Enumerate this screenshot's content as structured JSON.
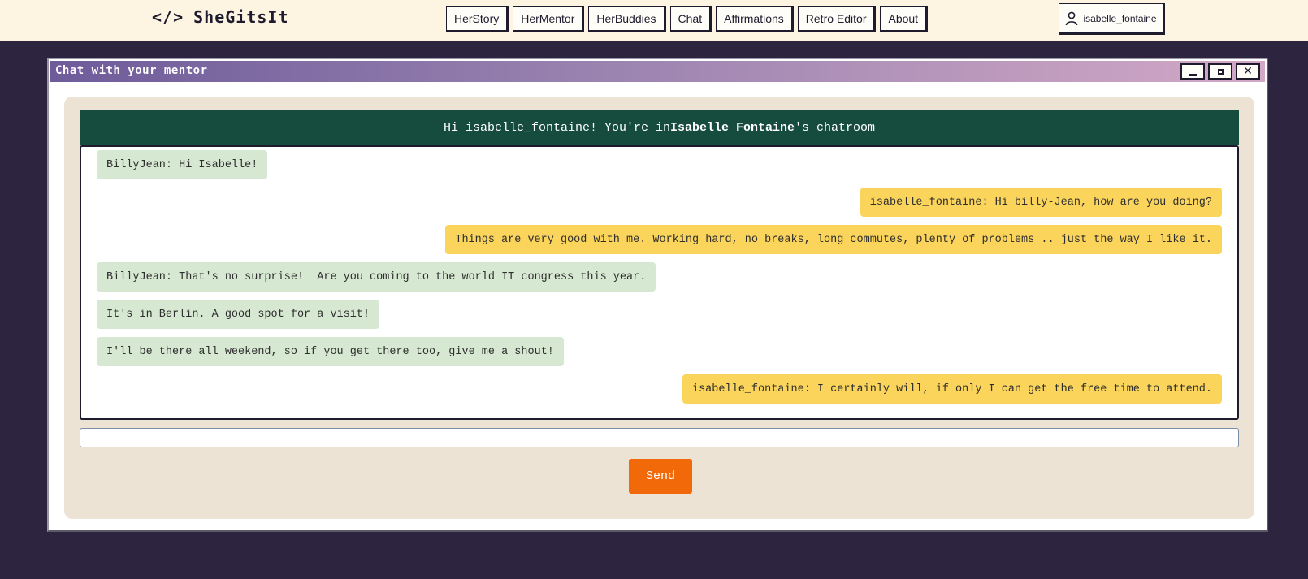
{
  "app": {
    "logo_mark": "</>",
    "logo_text": "SheGitsIt"
  },
  "nav": {
    "links": [
      "HerStory",
      "HerMentor",
      "HerBuddies",
      "Chat",
      "Affirmations",
      "Retro Editor",
      "About"
    ],
    "user_label": "isabelle_fontaine",
    "user_icon": "user-icon"
  },
  "window": {
    "title": "Chat with your mentor",
    "controls": {
      "minimize": "_",
      "maximize": "□",
      "close": "✕"
    }
  },
  "chat": {
    "header_prefix": "Hi isabelle_fontaine! You're in",
    "header_name": "Isabelle Fontaine",
    "header_suffix": "'s chatroom",
    "messages": [
      {
        "side": "other",
        "text": "BillyJean: Hi Isabelle!"
      },
      {
        "side": "mine",
        "text": "isabelle_fontaine: Hi billy-Jean, how are you doing?"
      },
      {
        "side": "mine",
        "text": "Things are very good with me. Working hard, no breaks, long commutes, plenty of problems .. just the way I like it."
      },
      {
        "side": "other",
        "text": "BillyJean: That's no surprise!  Are you coming to the world IT congress this year."
      },
      {
        "side": "other",
        "text": "It's in Berlin. A good spot for a visit!"
      },
      {
        "side": "other",
        "text": "I'll be there all weekend, so if you get there too, give me a shout!"
      },
      {
        "side": "mine",
        "text": "isabelle_fontaine: I certainly will, if only I can get the free time to attend."
      }
    ],
    "input_value": "",
    "send_label": "Send"
  },
  "colors": {
    "page_bg": "#2d2540",
    "navbar_bg": "#fdf5e2",
    "header_bg": "#164c3e",
    "other_bubble": "#d7e8d2",
    "mine_bubble": "#fbd55b",
    "send_button": "#f2690a"
  }
}
